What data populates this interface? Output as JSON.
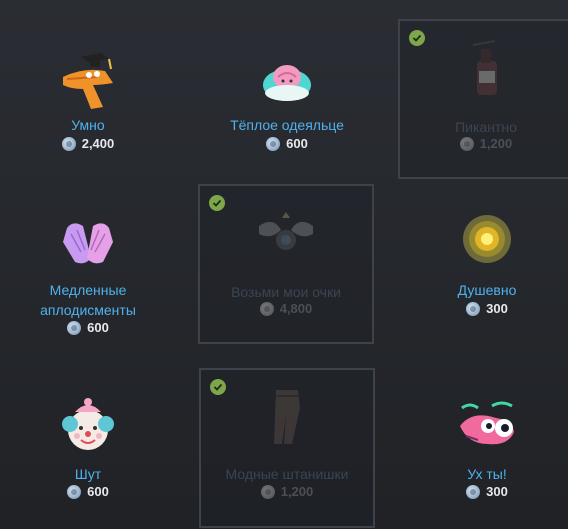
{
  "items": [
    {
      "name": "Умно",
      "price": "2,400",
      "owned": false,
      "icon": "dino-graduate-icon"
    },
    {
      "name": "Тёплое одеяльце",
      "price": "600",
      "owned": false,
      "icon": "blanket-brain-icon"
    },
    {
      "name": "Пикантно",
      "price": "1,200",
      "owned": true,
      "icon": "hot-sauce-icon"
    },
    {
      "name": "Медленные аплодисменты",
      "name_line1": "Медленные",
      "name_line2": "аплодисменты",
      "price": "600",
      "owned": false,
      "icon": "clapping-hands-icon"
    },
    {
      "name": "Возьми мои очки",
      "price": "4,800",
      "owned": true,
      "icon": "winged-badge-icon"
    },
    {
      "name": "Душевно",
      "price": "300",
      "owned": false,
      "icon": "golden-orb-icon"
    },
    {
      "name": "Шут",
      "price": "600",
      "owned": false,
      "icon": "clown-face-icon"
    },
    {
      "name": "Модные штанишки",
      "price": "1,200",
      "owned": true,
      "icon": "fancy-pants-icon"
    },
    {
      "name": "Ух ты!",
      "price": "300",
      "owned": false,
      "icon": "wow-monster-icon"
    }
  ]
}
